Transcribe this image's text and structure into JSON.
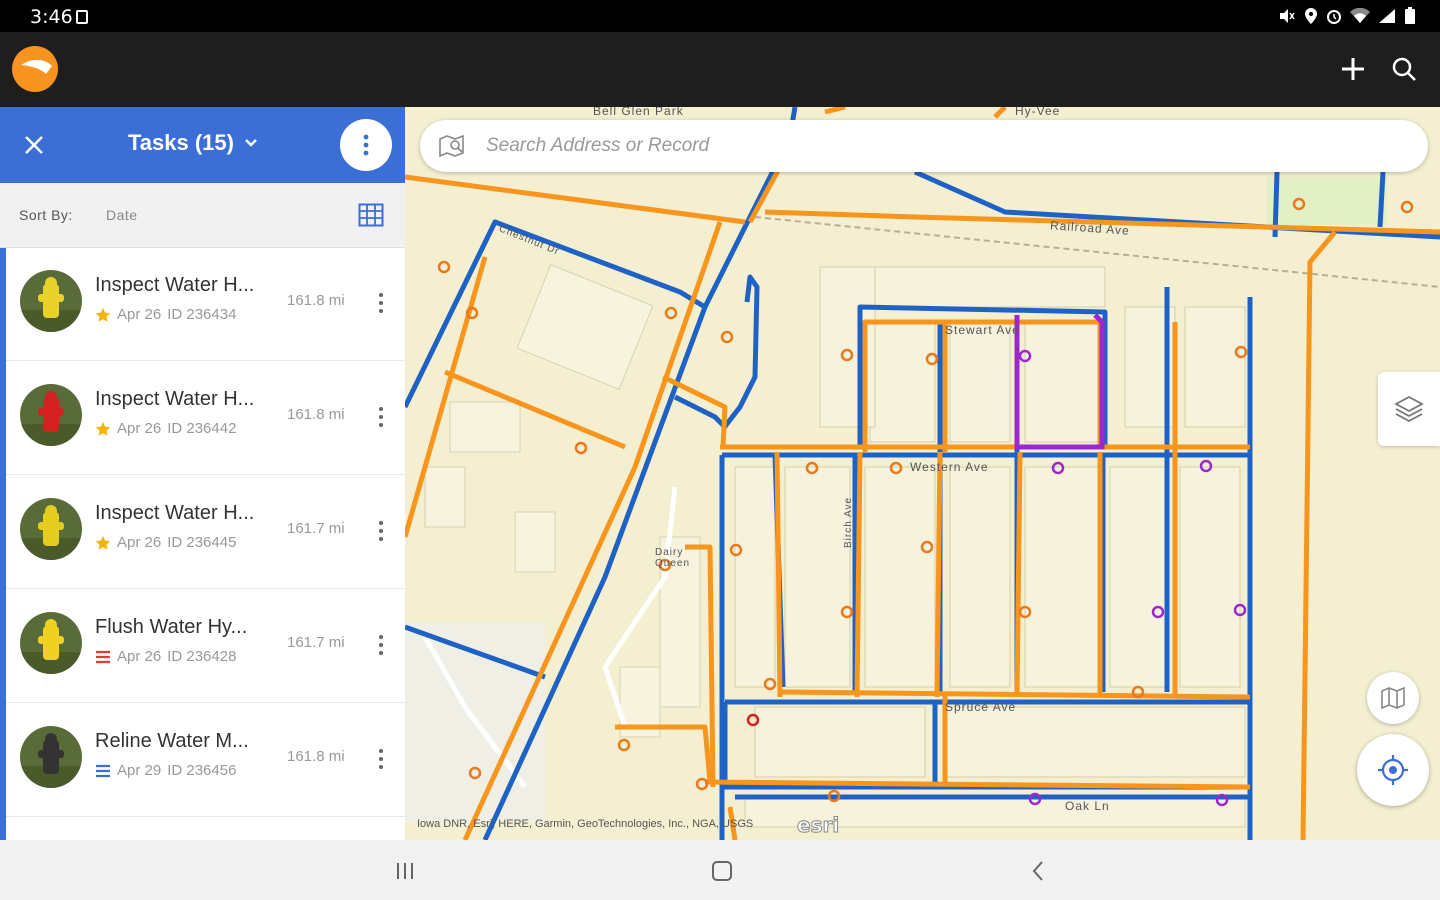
{
  "status": {
    "time": "3:46"
  },
  "app": {
    "add_icon": "plus-icon",
    "search_icon": "search-icon"
  },
  "panel": {
    "title": "Tasks (15)",
    "sort_label": "Sort By:",
    "sort_value": "Date"
  },
  "tasks": [
    {
      "title": "Inspect Water H...",
      "date": "Apr 26",
      "id": "ID 236434",
      "distance": "161.8 mi",
      "priority_icon": "star-icon",
      "priority_color": "#f5b400",
      "avatar_color": "#e8d22a"
    },
    {
      "title": "Inspect Water H...",
      "date": "Apr 26",
      "id": "ID 236442",
      "distance": "161.8 mi",
      "priority_icon": "star-icon",
      "priority_color": "#f5b400",
      "avatar_color": "#d42020"
    },
    {
      "title": "Inspect Water H...",
      "date": "Apr 26",
      "id": "ID 236445",
      "distance": "161.7 mi",
      "priority_icon": "star-icon",
      "priority_color": "#f5b400",
      "avatar_color": "#e5cd20"
    },
    {
      "title": "Flush Water Hy...",
      "date": "Apr 26",
      "id": "ID 236428",
      "distance": "161.7 mi",
      "priority_icon": "bars-icon",
      "priority_color": "#e53935",
      "avatar_color": "#f0d020"
    },
    {
      "title": "Reline Water M...",
      "date": "Apr 29",
      "id": "ID 236456",
      "distance": "161.8 mi",
      "priority_icon": "bars-icon",
      "priority_color": "#3c6fd6",
      "avatar_color": "#333333"
    }
  ],
  "map": {
    "search_placeholder": "Search Address or Record",
    "attribution": "Iowa DNR, Esri, HERE, Garmin, GeoTechnologies, Inc., NGA, USGS",
    "esri": "esri",
    "streets": {
      "railroad": "Railroad Ave",
      "western": "Western Ave",
      "spruce": "Spruce Ave",
      "oak": "Oak Ln",
      "bell_glen": "Bell Glen Park",
      "hy_vee": "Hy-Vee",
      "dairy_queen": "Dairy Queen",
      "stewart": "Stewart Ave",
      "chestnut": "Chestnut Dr",
      "birch": "Birch Ave"
    }
  },
  "colors": {
    "accent_blue": "#3c6fd6",
    "pipe_orange": "#f7951d",
    "pipe_blue": "#1f62c5",
    "selection_purple": "#9c27d0"
  }
}
